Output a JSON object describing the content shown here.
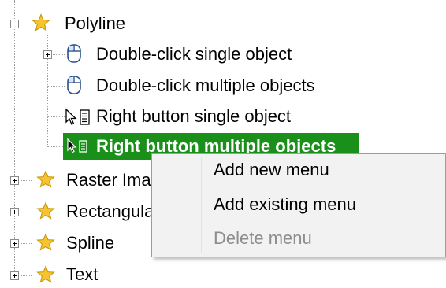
{
  "tree": {
    "polyline": {
      "label": "Polyline",
      "expanded": true
    },
    "children": [
      {
        "label": "Double-click single object",
        "icon": "mouse-icon",
        "expandable": true
      },
      {
        "label": "Double-click multiple objects",
        "icon": "mouse-icon",
        "expandable": false
      },
      {
        "label": "Right button single object",
        "icon": "cursor-menu-icon",
        "expandable": false
      },
      {
        "label": "Right button multiple objects",
        "icon": "cursor-menu-icon",
        "expandable": false,
        "selected": true
      }
    ],
    "siblings": [
      {
        "label": "Raster Ima",
        "icon": "star-icon"
      },
      {
        "label": "Rectangula",
        "icon": "star-icon"
      },
      {
        "label": "Spline",
        "icon": "star-icon"
      },
      {
        "label": "Text",
        "icon": "star-icon"
      }
    ]
  },
  "context_menu": {
    "items": [
      {
        "label": "Add new menu",
        "enabled": true
      },
      {
        "label": "Add existing menu",
        "enabled": true
      },
      {
        "label": "Delete menu",
        "enabled": false
      }
    ]
  },
  "colors": {
    "selection": "#1a8f1a",
    "star_fill": "#f5c430",
    "star_stroke": "#c99400",
    "menu_bg": "#f2f2f2",
    "disabled_text": "#8d8d8d"
  }
}
